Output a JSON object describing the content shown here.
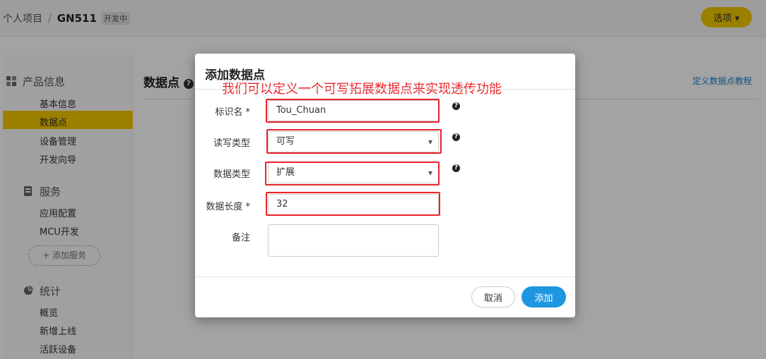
{
  "header": {
    "breadcrumb_root": "个人项目",
    "separator": "/",
    "project_name": "GN511",
    "status_badge": "开发中",
    "options_label": "选项"
  },
  "sidebar": {
    "sections": [
      {
        "title": "产品信息",
        "icon": "grid-icon",
        "items": [
          "基本信息",
          "数据点",
          "设备管理",
          "开发向导"
        ]
      },
      {
        "title": "服务",
        "icon": "service-icon",
        "items": [
          "应用配置",
          "MCU开发"
        ]
      },
      {
        "title": "统计",
        "icon": "pie-chart-icon",
        "items": [
          "概览",
          "新增上线",
          "活跃设备"
        ]
      }
    ],
    "active_item": "数据点",
    "add_service_label": "+ 添加服务"
  },
  "main": {
    "title": "数据点",
    "tutorial_link": "定义数据点教程"
  },
  "modal": {
    "title": "添加数据点",
    "annotation": "我们可以定义一个可写拓展数据点来实现透传功能",
    "fields": {
      "identifier": {
        "label": "标识名 *",
        "value": "Tou_Chuan"
      },
      "rw_type": {
        "label": "读写类型",
        "value": "可写"
      },
      "data_type": {
        "label": "数据类型",
        "value": "扩展"
      },
      "data_length": {
        "label": "数据长度 *",
        "value": "32"
      },
      "remark": {
        "label": "备注",
        "value": ""
      }
    },
    "cancel_label": "取消",
    "add_label": "添加"
  },
  "colors": {
    "accent_yellow": "#f2c800",
    "primary_blue": "#1f97e0",
    "annotation_red": "#e8232a",
    "link_blue": "#1a7ec4"
  }
}
